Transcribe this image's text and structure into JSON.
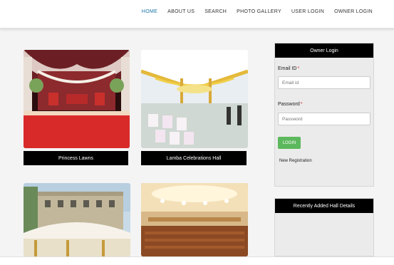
{
  "nav": {
    "items": [
      {
        "label": "HOME",
        "active": true
      },
      {
        "label": "ABOUT US",
        "active": false
      },
      {
        "label": "SEARCH",
        "active": false
      },
      {
        "label": "PHOTO GALLERY",
        "active": false
      },
      {
        "label": "USER LOGIN",
        "active": false
      },
      {
        "label": "OWNER LOGIN",
        "active": false
      }
    ],
    "active_color": "#1a73a8"
  },
  "halls": [
    {
      "name": "Princess Lawns"
    },
    {
      "name": "Lamba Celebrations Hall"
    },
    {
      "name": ""
    },
    {
      "name": ""
    }
  ],
  "owner_login": {
    "title": "Owner Login",
    "email_label": "Email ID",
    "email_placeholder": "Email id",
    "password_label": "Password",
    "password_placeholder": "Password",
    "required_mark": "*",
    "login_button": "LOGIN",
    "new_registration": "New Registration",
    "login_button_color": "#5cb85c"
  },
  "recent": {
    "title": "Recently Added Hall Details"
  }
}
